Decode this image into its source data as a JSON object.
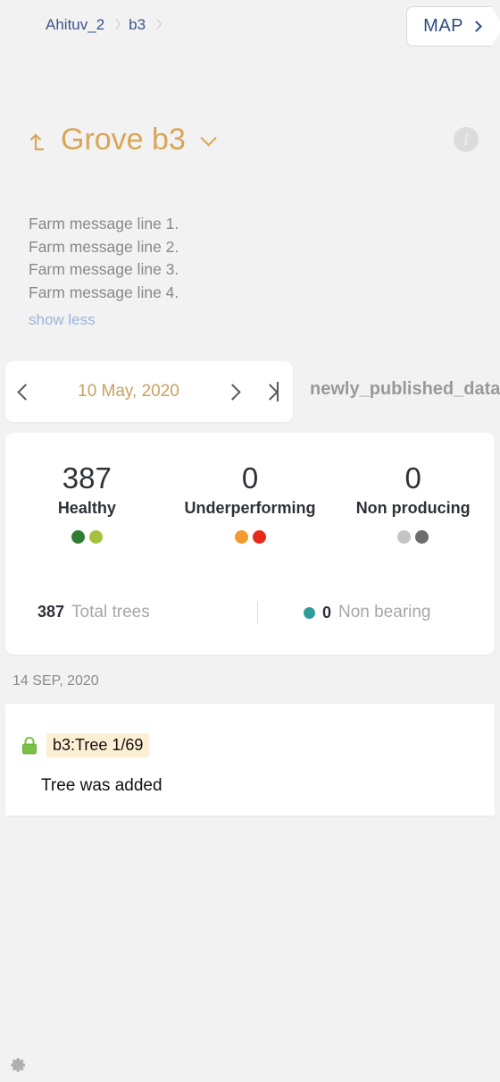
{
  "topbar": {
    "breadcrumb": [
      {
        "label": "Ahituv_2"
      },
      {
        "label": "b3"
      }
    ],
    "map_button": {
      "label": "MAP",
      "icon": "chevron-right-icon"
    }
  },
  "header": {
    "back_icon": "arrow-turn-up-left-icon",
    "title": "Grove b3",
    "dropdown_icon": "chevron-down-icon",
    "info_icon": "info-circle-icon",
    "title_color": "#d9a657"
  },
  "farm_message": {
    "lines": [
      "Farm message line 1.",
      "Farm message line 2.",
      "Farm message line 3.",
      "Farm message line 4."
    ],
    "toggle_label": "show less",
    "toggle_color": "#9ab4e0"
  },
  "date_nav": {
    "prev_icon": "chevron-left-icon",
    "date": "10 May, 2020",
    "next_icon": "chevron-right-icon",
    "last_icon": "skip-to-end-icon",
    "date_color": "#c8a063"
  },
  "published_label": "newly_published_data",
  "stats": {
    "columns": [
      {
        "value": "387",
        "label": "Healthy",
        "dots": [
          "#2f7d32",
          "#a4c33d"
        ]
      },
      {
        "value": "0",
        "label": "Underperforming",
        "dots": [
          "#f59a2e",
          "#e8291c"
        ]
      },
      {
        "value": "0",
        "label": "Non producing",
        "dots": [
          "#c4c4c4",
          "#6d6d6d"
        ]
      }
    ],
    "total": {
      "value": "387",
      "label": "Total trees"
    },
    "non_bearing": {
      "value": "0",
      "label": "Non bearing",
      "dot_color": "#2f9e9b"
    }
  },
  "activity": {
    "date": "14 SEP, 2020",
    "items": [
      {
        "icon": "lock-icon",
        "chip": "b3:Tree 1/69",
        "chip_bg": "#fdefd3",
        "text": "Tree was added"
      }
    ]
  },
  "footer": {
    "settings_icon": "gear-icon"
  }
}
